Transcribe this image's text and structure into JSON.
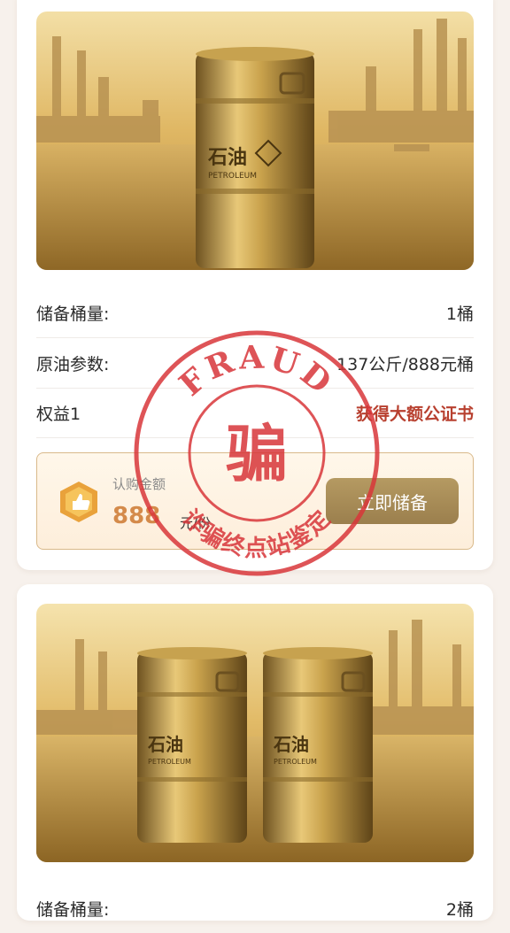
{
  "product1": {
    "barrel_label_cn": "石油",
    "barrel_label_en": "PETROLEUM",
    "rows": [
      {
        "label": "储备桶量:",
        "value": "1桶"
      },
      {
        "label": "原油参数:",
        "value": "137公斤/888元桶"
      },
      {
        "label": "权益1",
        "value": "获得大额公证书"
      }
    ],
    "amount_label": "认购金额",
    "amount": "888",
    "amount_unit": "元/份",
    "buy_button": "立即储备"
  },
  "product2": {
    "barrel_label_cn": "石油",
    "barrel_label_en": "PETROLEUM",
    "rows": [
      {
        "label": "储备桶量:",
        "value": "2桶"
      }
    ]
  },
  "stamp": {
    "top_text": "FRAUD",
    "center_text": "骗",
    "bottom_text": "诈骗终点站鉴定",
    "color": "#d8363a"
  },
  "colors": {
    "accent_gold": "#a98d58",
    "value_red": "#b8402f",
    "page_bg": "#f7f1ec"
  }
}
